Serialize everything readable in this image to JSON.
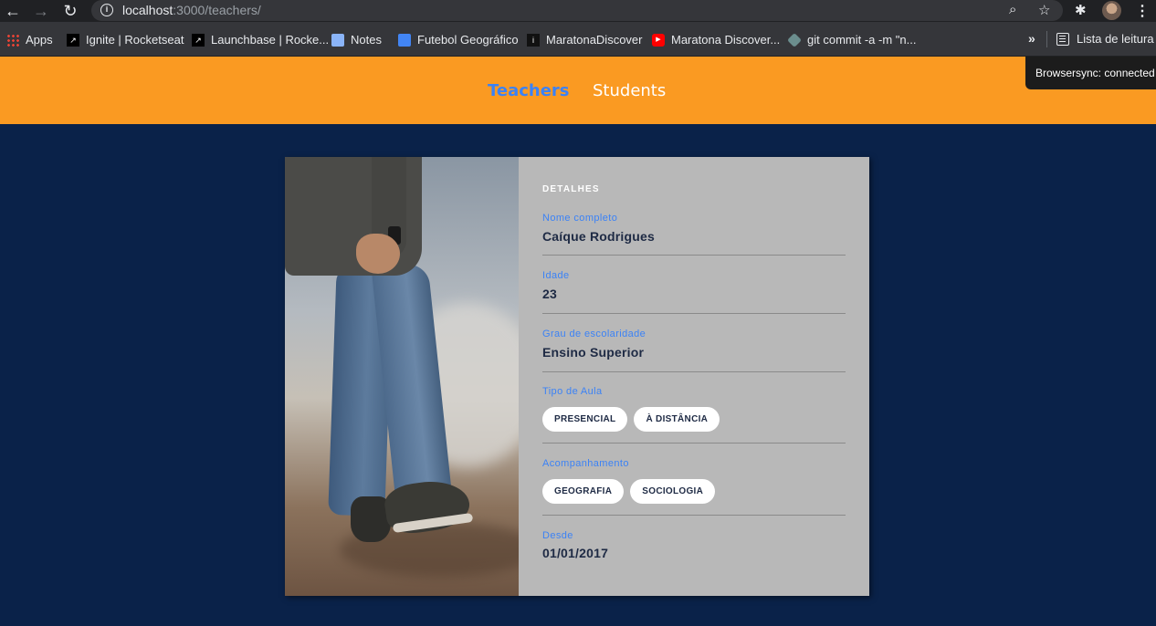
{
  "browser": {
    "url_host": "localhost",
    "url_path": ":3000/teachers/",
    "bookmarks": [
      {
        "label": "Apps",
        "icon": "apps-grid-icon"
      },
      {
        "label": "Ignite | Rocketseat",
        "icon": "rocketseat-icon"
      },
      {
        "label": "Launchbase | Rocke...",
        "icon": "rocketseat-icon"
      },
      {
        "label": "Notes",
        "icon": "notes-icon"
      },
      {
        "label": "Futebol Geográfico",
        "icon": "google-docs-icon"
      },
      {
        "label": "MaratonaDiscover",
        "icon": "maratona-icon"
      },
      {
        "label": "Maratona Discover...",
        "icon": "youtube-icon"
      },
      {
        "label": "git commit -a -m \"n...",
        "icon": "git-icon"
      }
    ],
    "overflow_label": "»",
    "reading_list": "Lista de leitura"
  },
  "header": {
    "nav": [
      {
        "label": "Teachers",
        "active": true
      },
      {
        "label": "Students",
        "active": false
      }
    ],
    "active_color": "#3b82f6",
    "background": "#fa9a22"
  },
  "browsersync": "Browsersync: connected",
  "card": {
    "section_title": "DETALHES",
    "fields": {
      "name": {
        "label": "Nome completo",
        "value": "Caíque Rodrigues"
      },
      "age": {
        "label": "Idade",
        "value": "23"
      },
      "education": {
        "label": "Grau de escolaridade",
        "value": "Ensino Superior"
      },
      "class_type": {
        "label": "Tipo de Aula",
        "tags": [
          "PRESENCIAL",
          "À DISTÂNCIA"
        ]
      },
      "subjects": {
        "label": "Acompanhamento",
        "tags": [
          "GEOGRAFIA",
          "SOCIOLOGIA"
        ]
      },
      "since": {
        "label": "Desde",
        "value": "01/01/2017"
      }
    }
  },
  "colors": {
    "page_bg": "#0a2249",
    "card_bg": "#b8b8b8",
    "label": "#3b82f6",
    "value": "#1e2a44"
  }
}
